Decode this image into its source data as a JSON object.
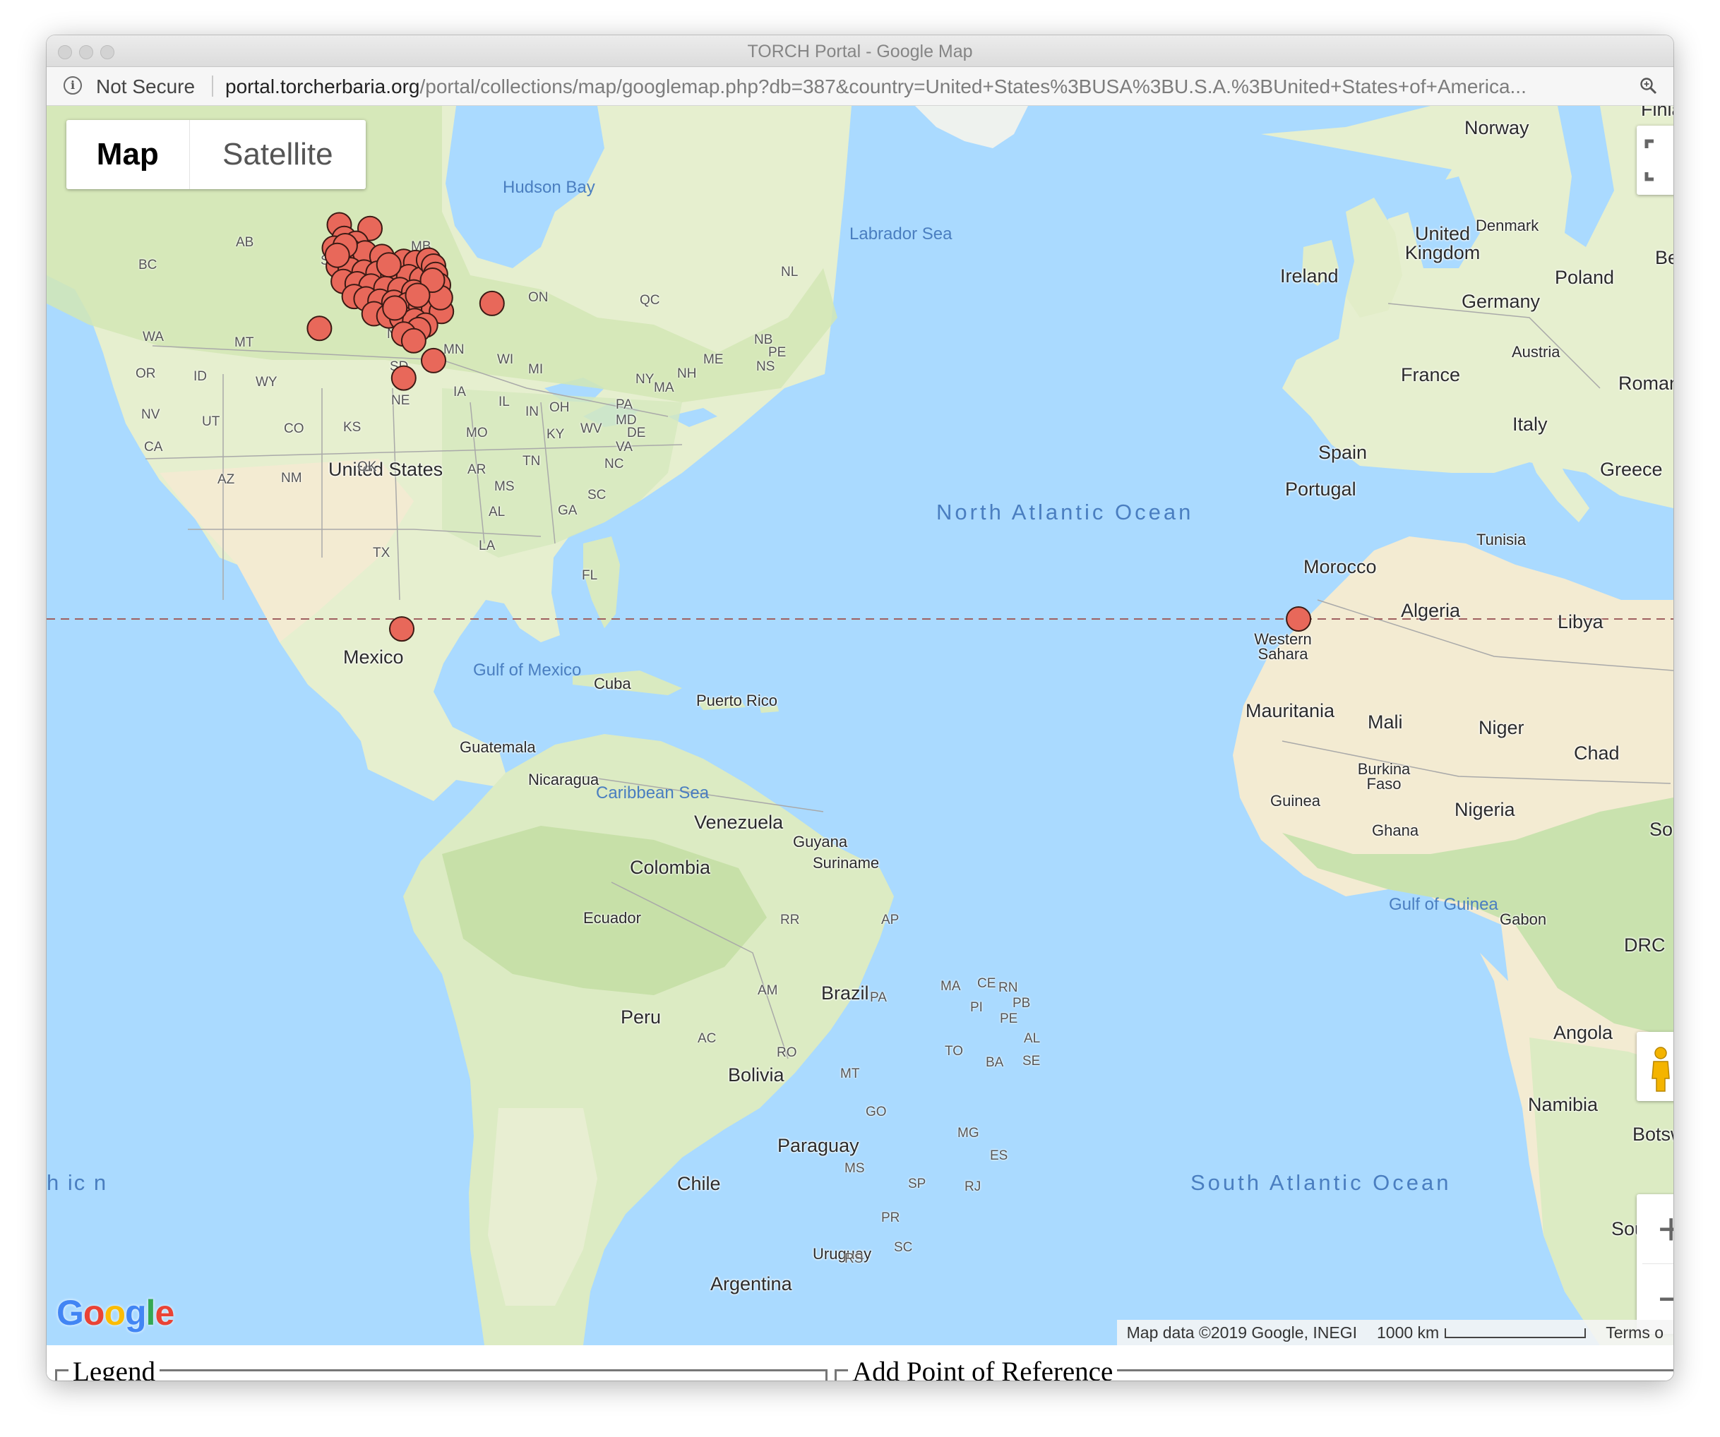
{
  "window": {
    "title": "TORCH Portal - Google Map"
  },
  "addressbar": {
    "security_label": "Not Secure",
    "url_host": "portal.torcherbaria.org",
    "url_path": "/portal/collections/map/googlemap.php?db=387&country=United+States%3BUSA%3BU.S.A.%3BUnited+States+of+America..."
  },
  "map": {
    "type_buttons": {
      "map": "Map",
      "satellite": "Satellite"
    },
    "selected_type": "Map",
    "labels": {
      "countries": [
        "United States",
        "Mexico",
        "Cuba",
        "Puerto Rico",
        "Guatemala",
        "Nicaragua",
        "Venezuela",
        "Colombia",
        "Guyana",
        "Suriname",
        "Ecuador",
        "Peru",
        "Brazil",
        "Bolivia",
        "Paraguay",
        "Chile",
        "Uruguay",
        "Argentina",
        "Norway",
        "Denmark",
        "United Kingdom",
        "Ireland",
        "Poland",
        "Germany",
        "Austria",
        "France",
        "Spain",
        "Portugal",
        "Italy",
        "Greece",
        "Tunisia",
        "Morocco",
        "Algeria",
        "Libya",
        "Western Sahara",
        "Mauritania",
        "Mali",
        "Niger",
        "Chad",
        "Burkina Faso",
        "Guinea",
        "Ghana",
        "Nigeria",
        "Gabon",
        "DRC",
        "Angola",
        "Namibia",
        "Botswan",
        "Roman",
        "Be",
        "So",
        "Sout",
        "Finla"
      ],
      "states": [
        "AB",
        "BC",
        "SK",
        "MB",
        "ON",
        "QC",
        "NL",
        "NB",
        "PE",
        "NS",
        "WA",
        "MT",
        "ND",
        "MN",
        "WI",
        "MI",
        "ME",
        "NH",
        "OR",
        "ID",
        "SD",
        "WY",
        "NY",
        "MA",
        "NE",
        "IA",
        "IL",
        "IN",
        "OH",
        "PA",
        "NV",
        "UT",
        "CO",
        "KS",
        "MO",
        "KY",
        "WV",
        "MD",
        "DE",
        "VA",
        "CA",
        "AZ",
        "NM",
        "OK",
        "AR",
        "TN",
        "NC",
        "MS",
        "SC",
        "AL",
        "GA",
        "LA",
        "TX",
        "FL",
        "RR",
        "AP",
        "AM",
        "PA",
        "MA",
        "CE",
        "RN",
        "PB",
        "PI",
        "PE",
        "AL",
        "AC",
        "RO",
        "MT",
        "TO",
        "BA",
        "SE",
        "GO",
        "MG",
        "ES",
        "MS",
        "SP",
        "RJ",
        "PR",
        "SC",
        "RS"
      ],
      "water": [
        "Hudson Bay",
        "Labrador Sea",
        "Gulf of Mexico",
        "Caribbean Sea",
        "Gulf of Guinea"
      ],
      "oceans": [
        "North Atlantic Ocean",
        "South Atlantic Ocean"
      ],
      "partial_left_ocean": "h ic n"
    },
    "markers": [
      {
        "lat": 36.9,
        "lng": -104.5
      },
      {
        "lat": 36.6,
        "lng": -101.4
      },
      {
        "lat": 35.8,
        "lng": -104.0
      },
      {
        "lat": 35.4,
        "lng": -102.8
      },
      {
        "lat": 35.0,
        "lng": -105.0
      },
      {
        "lat": 34.8,
        "lng": -103.5
      },
      {
        "lat": 34.6,
        "lng": -101.9
      },
      {
        "lat": 34.3,
        "lng": -100.2
      },
      {
        "lat": 33.9,
        "lng": -98.0
      },
      {
        "lat": 33.8,
        "lng": -96.8
      },
      {
        "lat": 33.5,
        "lng": -104.6
      },
      {
        "lat": 33.2,
        "lng": -103.4
      },
      {
        "lat": 33.0,
        "lng": -102.0
      },
      {
        "lat": 32.9,
        "lng": -100.6
      },
      {
        "lat": 32.7,
        "lng": -99.1
      },
      {
        "lat": 32.6,
        "lng": -97.5
      },
      {
        "lat": 32.4,
        "lng": -96.2
      },
      {
        "lat": 32.2,
        "lng": -104.1
      },
      {
        "lat": 32.0,
        "lng": -102.7
      },
      {
        "lat": 31.8,
        "lng": -101.3
      },
      {
        "lat": 31.6,
        "lng": -99.8
      },
      {
        "lat": 31.5,
        "lng": -98.4
      },
      {
        "lat": 31.3,
        "lng": -97.0
      },
      {
        "lat": 31.1,
        "lng": -95.6
      },
      {
        "lat": 30.9,
        "lng": -103.0
      },
      {
        "lat": 30.7,
        "lng": -101.8
      },
      {
        "lat": 30.5,
        "lng": -100.4
      },
      {
        "lat": 30.4,
        "lng": -99.0
      },
      {
        "lat": 30.2,
        "lng": -97.6
      },
      {
        "lat": 30.0,
        "lng": -96.3
      },
      {
        "lat": 29.8,
        "lng": -95.0
      },
      {
        "lat": 29.6,
        "lng": -94.2
      },
      {
        "lat": 29.4,
        "lng": -101.0
      },
      {
        "lat": 29.2,
        "lng": -99.5
      },
      {
        "lat": 29.0,
        "lng": -98.2
      },
      {
        "lat": 28.8,
        "lng": -96.9
      },
      {
        "lat": 28.4,
        "lng": -95.8
      },
      {
        "lat": 28.0,
        "lng": -96.5
      },
      {
        "lat": 27.6,
        "lng": -98.0
      },
      {
        "lat": 27.0,
        "lng": -97.0
      },
      {
        "lat": 34.0,
        "lng": -95.5
      },
      {
        "lat": 33.5,
        "lng": -95.0
      },
      {
        "lat": 32.8,
        "lng": -94.8
      },
      {
        "lat": 31.9,
        "lng": -94.5
      },
      {
        "lat": 30.8,
        "lng": -94.3
      },
      {
        "lat": 30.3,
        "lng": -89.1
      },
      {
        "lat": 28.1,
        "lng": -106.5
      },
      {
        "lat": 25.2,
        "lng": -95.0
      },
      {
        "lat": 23.6,
        "lng": -98.0
      },
      {
        "lat": -1.0,
        "lng": -98.2
      },
      {
        "lat": 0.0,
        "lng": -7.8
      },
      {
        "lat": 35.2,
        "lng": -103.9
      },
      {
        "lat": 34.4,
        "lng": -104.7
      },
      {
        "lat": 33.6,
        "lng": -99.5
      },
      {
        "lat": 32.3,
        "lng": -95.1
      },
      {
        "lat": 31.0,
        "lng": -96.6
      },
      {
        "lat": 29.9,
        "lng": -98.9
      }
    ],
    "marker_color": "#e8685a",
    "equator_line_color": "#a06060",
    "attribution": {
      "data": "Map data ©2019 Google, INEGI",
      "scale": "1000 km",
      "terms": "Terms o"
    },
    "logo": "Google"
  },
  "bottom": {
    "legend_title": "Legend",
    "reference_title": "Add Point of Reference"
  },
  "colors": {
    "water": "#aadaff",
    "land": "#e6efcf",
    "forest": "#c9e2ae",
    "desert": "#f3ebd2"
  }
}
